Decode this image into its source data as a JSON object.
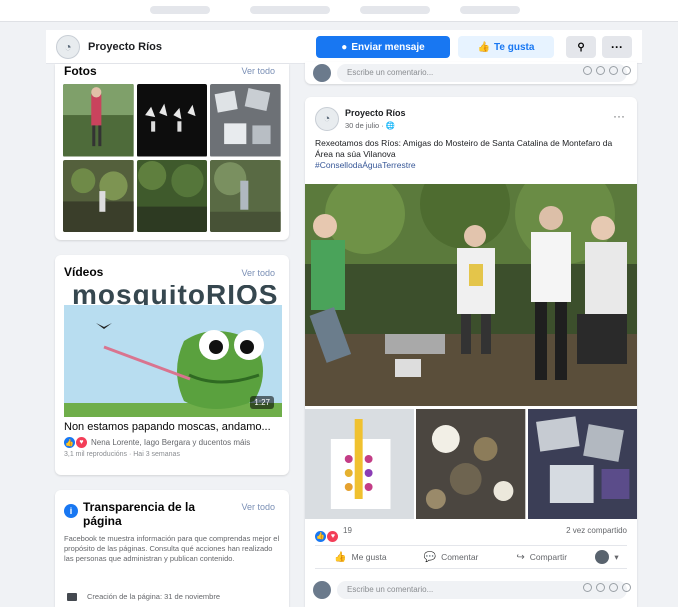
{
  "page": {
    "name": "Proyecto Ríos"
  },
  "header": {
    "send_message": "Enviar mensaje",
    "like_label": "Te gusta",
    "search_icon": "search-icon",
    "more_icon": "more-icon"
  },
  "photos": {
    "title": "Fotos",
    "see_all": "Ver todo"
  },
  "videos": {
    "title": "Vídeos",
    "see_all": "Ver todo",
    "banner_text": "mosquitoRÍOS",
    "duration": "1:27",
    "caption": "Non estamos papando moscas, andamo...",
    "reactions": "Nena Lorente, Iago Bergara y ducentos máis",
    "meta": "3,1 mil reproducións · Hai 3 semanas"
  },
  "transparency": {
    "title": "Transparencia de la página",
    "see_all": "Ver todo",
    "body": "Facebook te muestra información para que comprendas mejor el propósito de las páginas. Consulta qué acciones han realizado las personas que administran y publican contenido.",
    "created": "Creación de la página: 31 de noviembre"
  },
  "comment_top": {
    "placeholder": "Escribe un comentario..."
  },
  "post": {
    "author": "Proyecto Ríos",
    "time": "30 de julio · 🌐",
    "text": "Rexeotamos dos Ríos: Amigas do Mosteiro de Santa Catalina de Montefaro da Área na súa Vilanova",
    "hashtag": "#ConsellodaÁguaTerrestre",
    "like_count": "19",
    "shares": "2 vez compartido",
    "actions": {
      "like": "Me gusta",
      "comment": "Comentar",
      "share": "Compartir"
    },
    "comment_placeholder": "Escribe un comentario..."
  },
  "colors": {
    "brand": "#1877f2",
    "background": "#f0f2f5",
    "card": "#ffffff"
  }
}
